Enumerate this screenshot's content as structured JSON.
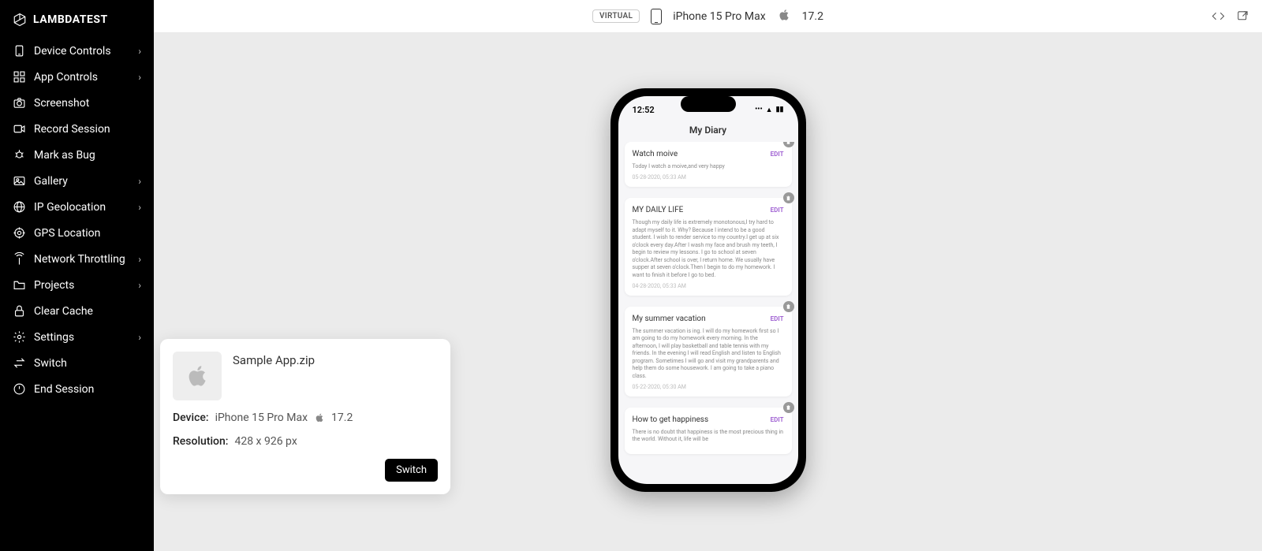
{
  "brand": "LAMBDATEST",
  "sidebar": {
    "items": [
      {
        "label": "Device Controls",
        "chevron": true,
        "icon": "phone"
      },
      {
        "label": "App Controls",
        "chevron": true,
        "icon": "apps"
      },
      {
        "label": "Screenshot",
        "chevron": false,
        "icon": "camera"
      },
      {
        "label": "Record Session",
        "chevron": false,
        "icon": "video"
      },
      {
        "label": "Mark as Bug",
        "chevron": false,
        "icon": "bug"
      },
      {
        "label": "Gallery",
        "chevron": true,
        "icon": "gallery"
      },
      {
        "label": "IP Geolocation",
        "chevron": true,
        "icon": "globe"
      },
      {
        "label": "GPS Location",
        "chevron": false,
        "icon": "target"
      },
      {
        "label": "Network Throttling",
        "chevron": true,
        "icon": "antenna"
      },
      {
        "label": "Projects",
        "chevron": true,
        "icon": "folder"
      },
      {
        "label": "Clear Cache",
        "chevron": false,
        "icon": "lock"
      },
      {
        "label": "Settings",
        "chevron": true,
        "icon": "gear"
      },
      {
        "label": "Switch",
        "chevron": false,
        "icon": "swap"
      },
      {
        "label": "End Session",
        "chevron": false,
        "icon": "power"
      }
    ]
  },
  "topbar": {
    "virtual": "VIRTUAL",
    "device": "iPhone 15 Pro Max",
    "os": "17.2"
  },
  "switch_card": {
    "app_name": "Sample App.zip",
    "device_label": "Device:",
    "device_value": "iPhone 15 Pro Max",
    "os_value": "17.2",
    "resolution_label": "Resolution:",
    "resolution_value": "428 x 926 px",
    "button": "Switch"
  },
  "phone": {
    "time": "12:52",
    "app_title": "My Diary",
    "edit_label": "EDIT",
    "entries": [
      {
        "title": "Watch moive",
        "body": "Today I watch a moive,and very happy",
        "date": "05-28-2020, 05:33 AM"
      },
      {
        "title": "MY DAILY LIFE",
        "body": "Though my daily life is extremely monotonous,I try hard to adapt myself to it. Why? Because I intend to be a good student. I wish to render service to my country.I get up at six o'clock every day.After I wash my face and brush my teeth, I begin to review my lessons. I go to school at seven o'clock.After school is over, I return home. We usually have supper at seven o'clock.Then I begin to do my homework. I want to finish it before I go to bed.",
        "date": "04-28-2020, 05:33 AM"
      },
      {
        "title": "My summer vacation",
        "body": "The summer vacation is ing. I will do my homework first so I am going to do my homework every morning. In the afternoon, I will play basketball and table tennis with my friends. In the evening I will read English and listen to English program. Sometimes I will go and visit my grandparents and help them do some housework. I am going to take a piano class.",
        "date": "05-22-2020, 05:30 AM"
      },
      {
        "title": "How to get happiness",
        "body": "There is no doubt that happiness is the most precious thing in the world. Without it, life will be",
        "date": ""
      }
    ]
  }
}
